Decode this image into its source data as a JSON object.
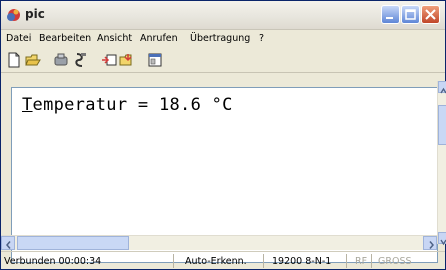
{
  "window": {
    "title": "pic"
  },
  "menu": {
    "items": [
      "Datei",
      "Bearbeiten",
      "Ansicht",
      "Anrufen",
      "Übertragung",
      "?"
    ]
  },
  "toolbar": {
    "icons": [
      "new-icon",
      "open-icon",
      "connect-icon",
      "disconnect-icon",
      "send-icon",
      "receive-icon",
      "properties-icon"
    ]
  },
  "terminal": {
    "lines": [
      "Temperatur = 18.6 °C"
    ]
  },
  "status": {
    "connected": "Verbunden 00:00:34",
    "detect": "Auto-Erkenn.",
    "settings": "19200 8-N-1",
    "rf": "RF",
    "gross": "GROSS"
  }
}
